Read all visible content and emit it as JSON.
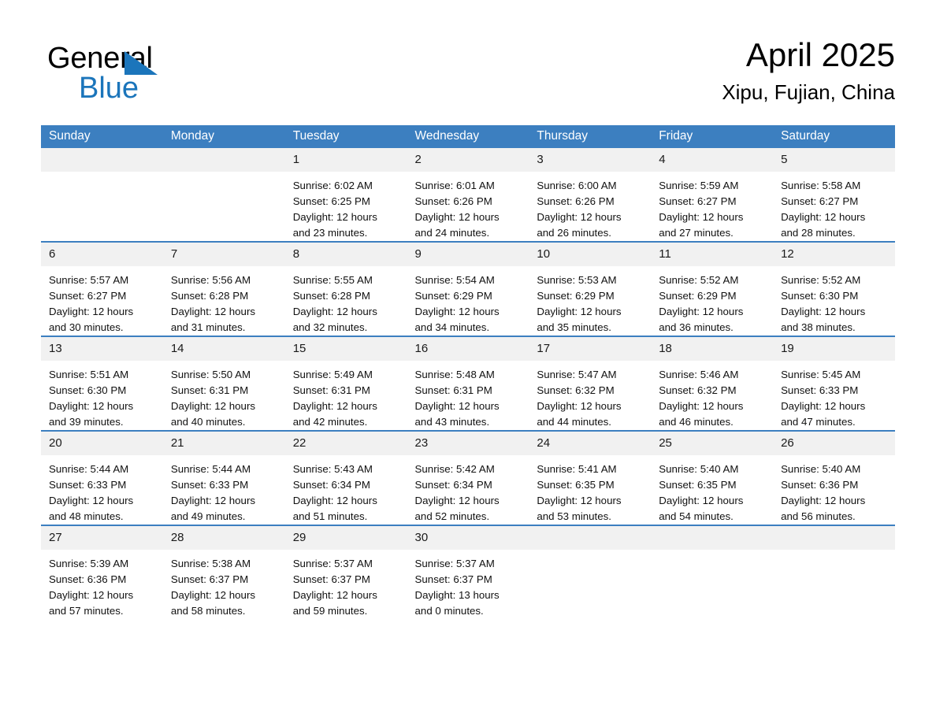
{
  "brand": {
    "name_part1": "General",
    "name_part2": "Blue"
  },
  "header": {
    "title": "April 2025",
    "location": "Xipu, Fujian, China"
  },
  "colors": {
    "header_blue": "#3c7fc0",
    "brand_blue": "#1b75bb",
    "daynum_background": "#f1f1f1"
  },
  "weekday_headers": [
    "Sunday",
    "Monday",
    "Tuesday",
    "Wednesday",
    "Thursday",
    "Friday",
    "Saturday"
  ],
  "weeks": [
    [
      {
        "day": "",
        "sunrise": "",
        "sunset": "",
        "daylight_line1": "",
        "daylight_line2": "",
        "empty": true
      },
      {
        "day": "",
        "sunrise": "",
        "sunset": "",
        "daylight_line1": "",
        "daylight_line2": "",
        "empty": true
      },
      {
        "day": "1",
        "sunrise": "Sunrise: 6:02 AM",
        "sunset": "Sunset: 6:25 PM",
        "daylight_line1": "Daylight: 12 hours",
        "daylight_line2": "and 23 minutes."
      },
      {
        "day": "2",
        "sunrise": "Sunrise: 6:01 AM",
        "sunset": "Sunset: 6:26 PM",
        "daylight_line1": "Daylight: 12 hours",
        "daylight_line2": "and 24 minutes."
      },
      {
        "day": "3",
        "sunrise": "Sunrise: 6:00 AM",
        "sunset": "Sunset: 6:26 PM",
        "daylight_line1": "Daylight: 12 hours",
        "daylight_line2": "and 26 minutes."
      },
      {
        "day": "4",
        "sunrise": "Sunrise: 5:59 AM",
        "sunset": "Sunset: 6:27 PM",
        "daylight_line1": "Daylight: 12 hours",
        "daylight_line2": "and 27 minutes."
      },
      {
        "day": "5",
        "sunrise": "Sunrise: 5:58 AM",
        "sunset": "Sunset: 6:27 PM",
        "daylight_line1": "Daylight: 12 hours",
        "daylight_line2": "and 28 minutes."
      }
    ],
    [
      {
        "day": "6",
        "sunrise": "Sunrise: 5:57 AM",
        "sunset": "Sunset: 6:27 PM",
        "daylight_line1": "Daylight: 12 hours",
        "daylight_line2": "and 30 minutes."
      },
      {
        "day": "7",
        "sunrise": "Sunrise: 5:56 AM",
        "sunset": "Sunset: 6:28 PM",
        "daylight_line1": "Daylight: 12 hours",
        "daylight_line2": "and 31 minutes."
      },
      {
        "day": "8",
        "sunrise": "Sunrise: 5:55 AM",
        "sunset": "Sunset: 6:28 PM",
        "daylight_line1": "Daylight: 12 hours",
        "daylight_line2": "and 32 minutes."
      },
      {
        "day": "9",
        "sunrise": "Sunrise: 5:54 AM",
        "sunset": "Sunset: 6:29 PM",
        "daylight_line1": "Daylight: 12 hours",
        "daylight_line2": "and 34 minutes."
      },
      {
        "day": "10",
        "sunrise": "Sunrise: 5:53 AM",
        "sunset": "Sunset: 6:29 PM",
        "daylight_line1": "Daylight: 12 hours",
        "daylight_line2": "and 35 minutes."
      },
      {
        "day": "11",
        "sunrise": "Sunrise: 5:52 AM",
        "sunset": "Sunset: 6:29 PM",
        "daylight_line1": "Daylight: 12 hours",
        "daylight_line2": "and 36 minutes."
      },
      {
        "day": "12",
        "sunrise": "Sunrise: 5:52 AM",
        "sunset": "Sunset: 6:30 PM",
        "daylight_line1": "Daylight: 12 hours",
        "daylight_line2": "and 38 minutes."
      }
    ],
    [
      {
        "day": "13",
        "sunrise": "Sunrise: 5:51 AM",
        "sunset": "Sunset: 6:30 PM",
        "daylight_line1": "Daylight: 12 hours",
        "daylight_line2": "and 39 minutes."
      },
      {
        "day": "14",
        "sunrise": "Sunrise: 5:50 AM",
        "sunset": "Sunset: 6:31 PM",
        "daylight_line1": "Daylight: 12 hours",
        "daylight_line2": "and 40 minutes."
      },
      {
        "day": "15",
        "sunrise": "Sunrise: 5:49 AM",
        "sunset": "Sunset: 6:31 PM",
        "daylight_line1": "Daylight: 12 hours",
        "daylight_line2": "and 42 minutes."
      },
      {
        "day": "16",
        "sunrise": "Sunrise: 5:48 AM",
        "sunset": "Sunset: 6:31 PM",
        "daylight_line1": "Daylight: 12 hours",
        "daylight_line2": "and 43 minutes."
      },
      {
        "day": "17",
        "sunrise": "Sunrise: 5:47 AM",
        "sunset": "Sunset: 6:32 PM",
        "daylight_line1": "Daylight: 12 hours",
        "daylight_line2": "and 44 minutes."
      },
      {
        "day": "18",
        "sunrise": "Sunrise: 5:46 AM",
        "sunset": "Sunset: 6:32 PM",
        "daylight_line1": "Daylight: 12 hours",
        "daylight_line2": "and 46 minutes."
      },
      {
        "day": "19",
        "sunrise": "Sunrise: 5:45 AM",
        "sunset": "Sunset: 6:33 PM",
        "daylight_line1": "Daylight: 12 hours",
        "daylight_line2": "and 47 minutes."
      }
    ],
    [
      {
        "day": "20",
        "sunrise": "Sunrise: 5:44 AM",
        "sunset": "Sunset: 6:33 PM",
        "daylight_line1": "Daylight: 12 hours",
        "daylight_line2": "and 48 minutes."
      },
      {
        "day": "21",
        "sunrise": "Sunrise: 5:44 AM",
        "sunset": "Sunset: 6:33 PM",
        "daylight_line1": "Daylight: 12 hours",
        "daylight_line2": "and 49 minutes."
      },
      {
        "day": "22",
        "sunrise": "Sunrise: 5:43 AM",
        "sunset": "Sunset: 6:34 PM",
        "daylight_line1": "Daylight: 12 hours",
        "daylight_line2": "and 51 minutes."
      },
      {
        "day": "23",
        "sunrise": "Sunrise: 5:42 AM",
        "sunset": "Sunset: 6:34 PM",
        "daylight_line1": "Daylight: 12 hours",
        "daylight_line2": "and 52 minutes."
      },
      {
        "day": "24",
        "sunrise": "Sunrise: 5:41 AM",
        "sunset": "Sunset: 6:35 PM",
        "daylight_line1": "Daylight: 12 hours",
        "daylight_line2": "and 53 minutes."
      },
      {
        "day": "25",
        "sunrise": "Sunrise: 5:40 AM",
        "sunset": "Sunset: 6:35 PM",
        "daylight_line1": "Daylight: 12 hours",
        "daylight_line2": "and 54 minutes."
      },
      {
        "day": "26",
        "sunrise": "Sunrise: 5:40 AM",
        "sunset": "Sunset: 6:36 PM",
        "daylight_line1": "Daylight: 12 hours",
        "daylight_line2": "and 56 minutes."
      }
    ],
    [
      {
        "day": "27",
        "sunrise": "Sunrise: 5:39 AM",
        "sunset": "Sunset: 6:36 PM",
        "daylight_line1": "Daylight: 12 hours",
        "daylight_line2": "and 57 minutes."
      },
      {
        "day": "28",
        "sunrise": "Sunrise: 5:38 AM",
        "sunset": "Sunset: 6:37 PM",
        "daylight_line1": "Daylight: 12 hours",
        "daylight_line2": "and 58 minutes."
      },
      {
        "day": "29",
        "sunrise": "Sunrise: 5:37 AM",
        "sunset": "Sunset: 6:37 PM",
        "daylight_line1": "Daylight: 12 hours",
        "daylight_line2": "and 59 minutes."
      },
      {
        "day": "30",
        "sunrise": "Sunrise: 5:37 AM",
        "sunset": "Sunset: 6:37 PM",
        "daylight_line1": "Daylight: 13 hours",
        "daylight_line2": "and 0 minutes."
      },
      {
        "day": "",
        "sunrise": "",
        "sunset": "",
        "daylight_line1": "",
        "daylight_line2": "",
        "empty": true
      },
      {
        "day": "",
        "sunrise": "",
        "sunset": "",
        "daylight_line1": "",
        "daylight_line2": "",
        "empty": true
      },
      {
        "day": "",
        "sunrise": "",
        "sunset": "",
        "daylight_line1": "",
        "daylight_line2": "",
        "empty": true
      }
    ]
  ]
}
